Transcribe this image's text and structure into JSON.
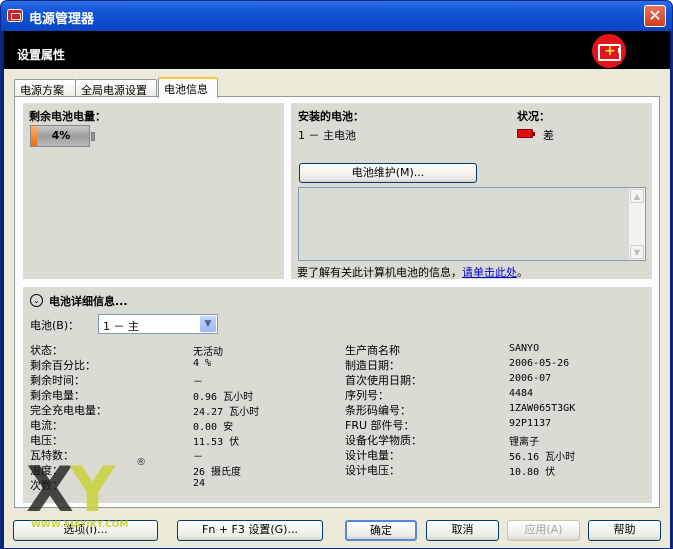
{
  "title": "电源管理器",
  "header": "设置属性",
  "tabs": [
    "电源方案",
    "全局电源设置",
    "电池信息"
  ],
  "remaining": {
    "label": "剩余电池电量：",
    "pct_text": "4%",
    "level": 0.04
  },
  "installed": {
    "label": "安装的电池：",
    "value": "1 － 主电池"
  },
  "status": {
    "label": "状况：",
    "value": "差",
    "color": "#e01010"
  },
  "maintenance_button": "电池维护(M)...",
  "info_text": "要了解有关此计算机电池的信息，",
  "info_link": "请单击此处",
  "info_end": "。",
  "details": {
    "title": "电池详细信息...",
    "battery_label": "电池(B)：",
    "battery_selected": "1 － 主",
    "left": [
      {
        "k": "状态：",
        "v": "无活动"
      },
      {
        "k": "剩余百分比：",
        "v": "4 %"
      },
      {
        "k": "剩余时间：",
        "v": "－"
      },
      {
        "k": "剩余电量：",
        "v": "0.96 瓦小时"
      },
      {
        "k": "完全充电电量：",
        "v": "24.27 瓦小时"
      },
      {
        "k": "电流：",
        "v": "0.00 安"
      },
      {
        "k": "电压：",
        "v": "11.53 伏"
      },
      {
        "k": "瓦特数：",
        "v": "－"
      },
      {
        "k": "温度：",
        "v": "26 摄氏度"
      },
      {
        "k": "次数：",
        "v": "24"
      }
    ],
    "right": [
      {
        "k": "生产商名称",
        "v": "SANYO"
      },
      {
        "k": "制造日期：",
        "v": "2006-05-26"
      },
      {
        "k": "首次使用日期：",
        "v": "2006-07"
      },
      {
        "k": "序列号：",
        "v": "4484"
      },
      {
        "k": "条形码编号：",
        "v": "1ZAW065T3GK"
      },
      {
        "k": "FRU 部件号：",
        "v": "92P1137"
      },
      {
        "k": "设备化学物质：",
        "v": "锂离子"
      },
      {
        "k": "设计电量：",
        "v": "56.16 瓦小时"
      },
      {
        "k": "设计电压：",
        "v": "10.80 伏"
      }
    ]
  },
  "buttons": {
    "options": "选项(I)...",
    "fn_f3": "Fn + F3 设置(G)...",
    "ok": "确定",
    "cancel": "取消",
    "apply": "应用(A)",
    "help": "帮助"
  },
  "watermark": {
    "text": "XY",
    "url": "WWW.XIAYIKY.COM",
    "reg": "®"
  }
}
